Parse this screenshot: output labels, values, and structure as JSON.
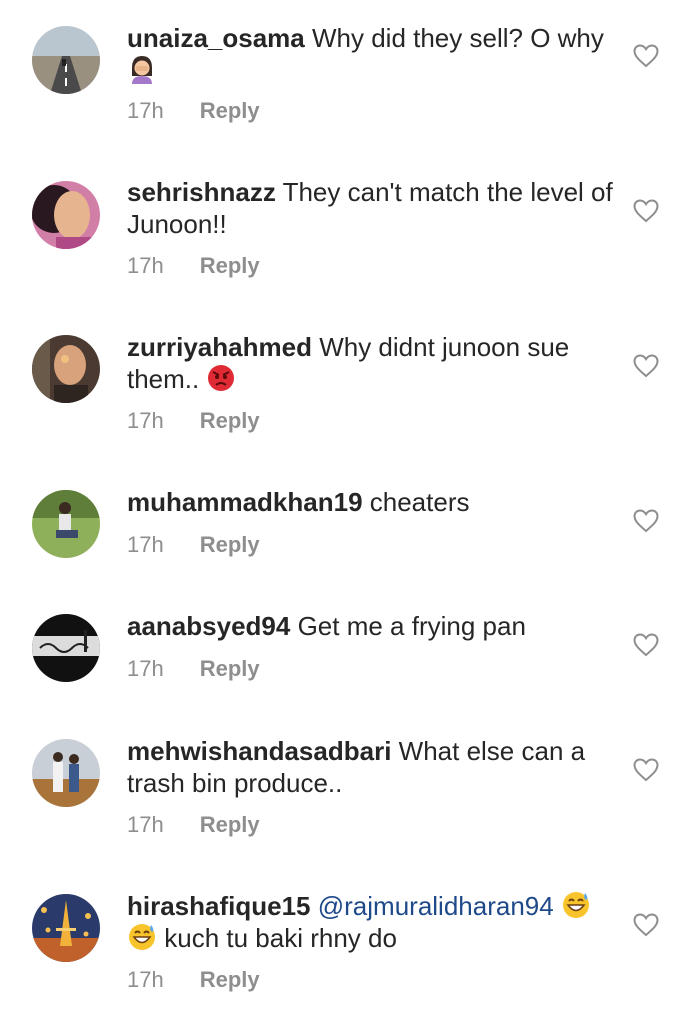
{
  "comments": [
    {
      "username": "unaiza_osama",
      "text_1": "Why did they sell? O why",
      "emoji_1": "woman-facepalming-emoji",
      "time": "17h",
      "reply_label": "Reply",
      "avatar": "avatar-road-photo"
    },
    {
      "username": "sehrishnazz",
      "text": "They can't match the level of Junoon!!",
      "time": "17h",
      "reply_label": "Reply",
      "avatar": "avatar-woman-photo"
    },
    {
      "username": "zurriyahahmed",
      "text_1": "Why didnt junoon sue them..",
      "emoji_1": "angry-face-emoji",
      "time": "17h",
      "reply_label": "Reply",
      "avatar": "avatar-face-photo"
    },
    {
      "username": "muhammadkhan19",
      "text": "cheaters",
      "time": "17h",
      "reply_label": "Reply",
      "avatar": "avatar-park-photo"
    },
    {
      "username": "aanabsyed94",
      "text": "Get me a frying pan",
      "time": "17h",
      "reply_label": "Reply",
      "avatar": "avatar-calligraphy-photo"
    },
    {
      "username": "mehwishandasadbari",
      "text": "What else can a trash bin produce..",
      "time": "17h",
      "reply_label": "Reply",
      "avatar": "avatar-couple-photo"
    },
    {
      "username": "hirashafique15",
      "mention": "@rajmuralidharan94",
      "emoji_1": "grinning-sweat-emoji",
      "emoji_2": "grinning-sweat-emoji",
      "text_2": "kuch tu baki rhny do",
      "time": "17h",
      "reply_label": "Reply",
      "avatar": "avatar-eiffel-photo"
    }
  ],
  "icons": {
    "like": "heart-outline-icon"
  },
  "colors": {
    "text": "#262626",
    "meta": "#8e8e8e",
    "mention": "#1f4a8a",
    "background": "#ffffff"
  }
}
